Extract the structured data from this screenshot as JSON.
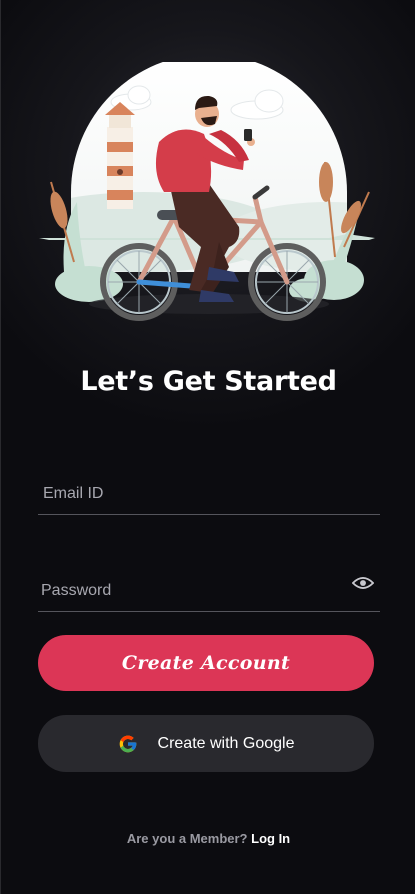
{
  "header": {
    "title": "Let’s Get Started"
  },
  "illustration": {
    "icon": "cyclist-illustration"
  },
  "form": {
    "email_placeholder": "Email ID",
    "password_placeholder": "Password",
    "password_toggle_icon": "eye-icon"
  },
  "actions": {
    "create_account_label": "Create Account",
    "google_label": "Create with Google",
    "google_icon": "google-icon"
  },
  "footer": {
    "question": "Are you a Member?",
    "login_label": "Log In"
  },
  "colors": {
    "background": "#0c0c10",
    "primary": "#dc3656",
    "secondary_button": "#29292e"
  }
}
